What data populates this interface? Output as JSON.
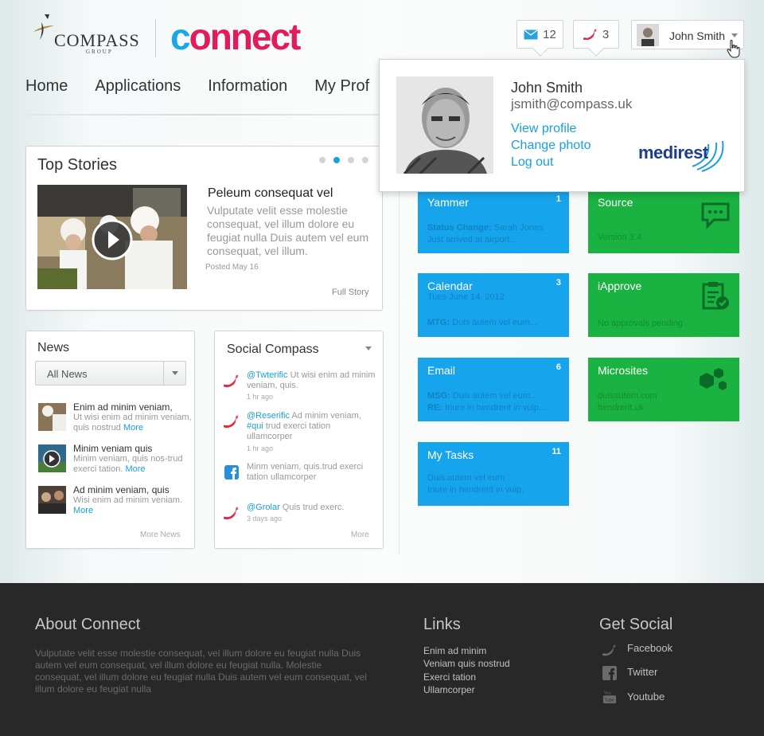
{
  "brand": {
    "name": "COMPASS",
    "sub": "GROUP",
    "app_name_first": "c",
    "app_name_rest": "onnect"
  },
  "header": {
    "mail_count": "12",
    "twitter_count": "3",
    "user_name": "John Smith"
  },
  "nav": {
    "items": [
      "Home",
      "Applications",
      "Information",
      "My Prof"
    ]
  },
  "profile": {
    "name": "John Smith",
    "email": "jsmith@compass.uk",
    "links": [
      "View profile",
      "Change photo",
      "Log out"
    ],
    "company": "medirest"
  },
  "top_stories": {
    "title": "Top Stories",
    "active_slide": 2,
    "slide_count": 4,
    "headline": "Peleum consequat vel",
    "body": "Vulputate velit esse molestie consequat, vel illum dolore eu feugiat nulla Duis autem vel eum consequat, vel illum.",
    "date": "Posted May 16",
    "link": "Full Story"
  },
  "news": {
    "title": "News",
    "filter": "All News",
    "items": [
      {
        "title": "Enim ad minim veniam,",
        "body": "Ut wisi enim ad minim veniam, quis nostrud",
        "more": "More"
      },
      {
        "title": "Minim veniam quis",
        "body": "Minim veniam, quis nos-trud exerci tation.",
        "more": "More"
      },
      {
        "title": "Ad minim veniam, quis",
        "body": "Wisi enim ad minim veniam.",
        "more": "More"
      }
    ],
    "more_link": "More News"
  },
  "social": {
    "title": "Social Compass",
    "items": [
      {
        "icon": "twitter-icon",
        "handle": "@Twterific",
        "text": " Ut wisi enim ad minim veniam, quis.",
        "time": "1 hr ago"
      },
      {
        "icon": "twitter-icon",
        "handle": "@Reserific",
        "text": " Ad minim veniam, ",
        "tag": "#qui",
        "text2": " trud exerci tation ullamcorper",
        "time": "1 hr ago"
      },
      {
        "icon": "facebook-icon",
        "handle": "",
        "text": "Minm veniam, quis.trud exerci tation ullamcorper",
        "time": ""
      },
      {
        "icon": "twitter-icon",
        "handle": "@Grolar",
        "text": " Quis trud exerc.",
        "time": "3 days ago"
      }
    ],
    "more_link": "More"
  },
  "tiles": [
    {
      "name": "Yammer",
      "count": "1",
      "lines": [
        {
          "b": "Status Change:",
          "t": " Sarah Jones"
        },
        {
          "b": "",
          "t": "Just arrived at airport..."
        }
      ],
      "color": "#16a5ec"
    },
    {
      "name": "Source",
      "count": "",
      "lines": [
        {
          "b": "",
          "t": "Version 3.4"
        }
      ],
      "color": "#1ab342"
    },
    {
      "name": "Calendar",
      "count": "3",
      "lines": [
        {
          "b": "",
          "t": "Tues June 14, 2012"
        },
        {
          "b": "MTG:",
          "t": " Duis autem vel eum..."
        }
      ],
      "color": "#16a5ec"
    },
    {
      "name": "iApprove",
      "count": "",
      "lines": [
        {
          "b": "",
          "t": "No approvals pending"
        }
      ],
      "color": "#1ab342"
    },
    {
      "name": "Email",
      "count": "6",
      "lines": [
        {
          "b": "MSG:",
          "t": " Duis autem vel eum..."
        },
        {
          "b": "RE:",
          "t": " Iriure  in hendrerit in vulp..."
        }
      ],
      "color": "#16a5ec"
    },
    {
      "name": "Microsites",
      "count": "",
      "lines": [
        {
          "b": "",
          "t": "duisautem.com"
        },
        {
          "b": "",
          "t": "hendrerit.uk"
        }
      ],
      "color": "#1ab342"
    },
    {
      "name": "My Tasks",
      "count": "11",
      "lines": [
        {
          "b": "",
          "t": "Duis autem vel eum"
        },
        {
          "b": "",
          "t": "Iriure  in hendrerit in vulp."
        }
      ],
      "color": "#16a5ec"
    }
  ],
  "footer": {
    "about_title": "About Connect",
    "about_text": "Vulputate velit esse molestie consequat, vel illum dolore eu feugiat nulla Duis autem vel eum consequat, vel illum dolore eu feugiat nulla. Molestie consequat, vel illum dolore eu feugiat nulla Duis autem vel eum consequat, vel illum dolore eu feugiat nulla",
    "links_title": "Links",
    "links": [
      "Enim ad minim",
      "Veniam quis nostrud",
      "Exerci tation",
      "Ullamcorper"
    ],
    "social_title": "Get Social",
    "social": [
      "Facebook",
      "Twitter",
      "Youtube"
    ]
  }
}
